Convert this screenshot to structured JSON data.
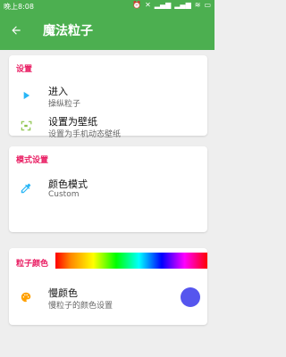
{
  "status_bar": {
    "time": "晚上8:08",
    "icons": [
      "alarm-icon",
      "mute-icon",
      "signal-icon",
      "signal-icon",
      "wifi-icon",
      "battery-icon"
    ]
  },
  "app_bar": {
    "title": "魔法粒子",
    "background": "#4CAF50"
  },
  "sections": {
    "settings": {
      "title": "设置",
      "items": [
        {
          "label": "进入",
          "sub": "操纵粒子",
          "icon": "play-icon",
          "icon_color": "#29B6F6"
        },
        {
          "label": "设置为壁纸",
          "sub": "设置为手机动态壁纸",
          "icon": "wallpaper-icon",
          "icon_color": "#8BC34A"
        }
      ]
    },
    "mode": {
      "title": "模式设置",
      "items": [
        {
          "label": "颜色模式",
          "sub": "Custom",
          "icon": "eyedropper-icon",
          "icon_color": "#29B6F6"
        }
      ]
    },
    "particle_color": {
      "title": "粒子颜色",
      "items": [
        {
          "label": "慢颜色",
          "sub": "慢粒子的颜色设置",
          "icon": "palette-icon",
          "icon_color": "#FFA000",
          "swatch": "#5555ee"
        }
      ]
    }
  },
  "accent_color": "#E91E63"
}
